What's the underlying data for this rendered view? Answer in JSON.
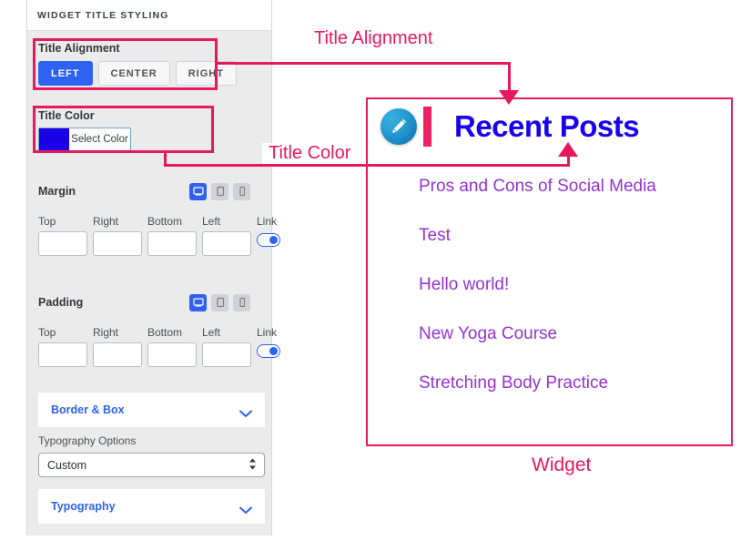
{
  "panel": {
    "header_title": "WIDGET TITLE STYLING",
    "title_alignment": {
      "label": "Title Alignment",
      "options": [
        "LEFT",
        "CENTER",
        "RIGHT"
      ],
      "selected": "LEFT",
      "active_color": "#2e62f0"
    },
    "title_color": {
      "label": "Title Color",
      "button_label": "Select Color",
      "swatch_hex": "#1b00e8"
    },
    "margin": {
      "label": "Margin",
      "devices": [
        "desktop-icon",
        "tablet-icon",
        "mobile-icon"
      ],
      "active_device": "desktop-icon",
      "field_labels": [
        "Top",
        "Right",
        "Bottom",
        "Left"
      ],
      "values": [
        "",
        "",
        "",
        ""
      ],
      "link_label": "Link",
      "link_on": true
    },
    "padding": {
      "label": "Padding",
      "devices": [
        "desktop-icon",
        "tablet-icon",
        "mobile-icon"
      ],
      "active_device": "desktop-icon",
      "field_labels": [
        "Top",
        "Right",
        "Bottom",
        "Left"
      ],
      "values": [
        "",
        "",
        "",
        ""
      ],
      "link_label": "Link",
      "link_on": true
    },
    "border_box_accordion": {
      "label": "Border & Box",
      "icon": "chevron-down-icon"
    },
    "typography_options": {
      "label": "Typography Options",
      "selected": "Custom"
    },
    "typography_accordion": {
      "label": "Typography",
      "icon": "chevron-down-icon"
    }
  },
  "widget": {
    "icon": "pencil-edit-icon",
    "title": "Recent Posts",
    "title_color_hex": "#1a00ee",
    "post_color_hex": "#9333d0",
    "posts": [
      "Pros and Cons of Social Media",
      "Test",
      "Hello world!",
      "New Yoga Course",
      "Stretching Body Practice"
    ]
  },
  "annotations": {
    "accent_hex": "#e8185e",
    "title_alignment_label": "Title Alignment",
    "title_color_label": "Title Color",
    "widget_label": "Widget"
  }
}
